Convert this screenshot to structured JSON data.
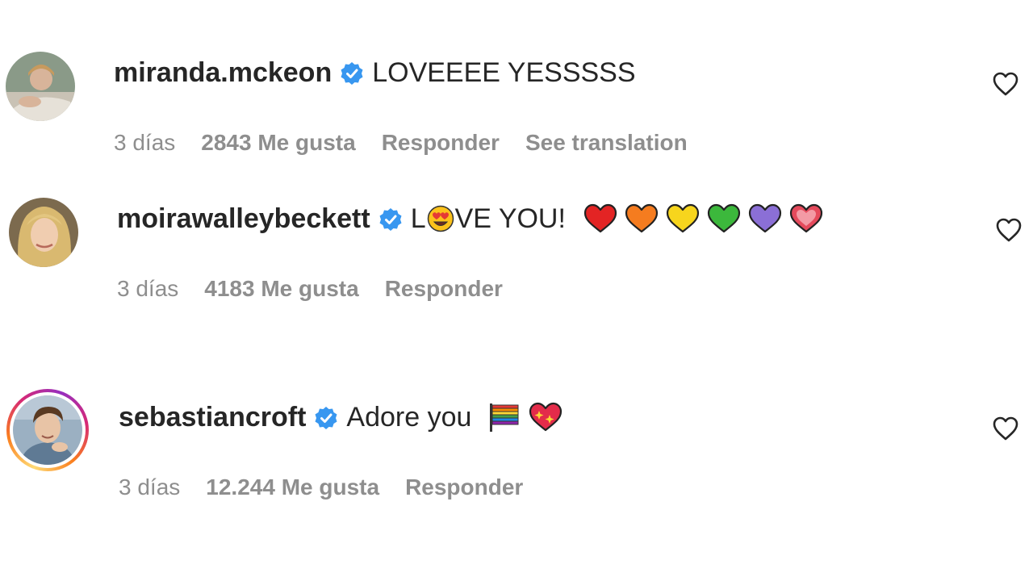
{
  "comments": [
    {
      "username": "miranda.mckeon",
      "text": "LOVEEEE YESSSSS",
      "time": "3 días",
      "likes": "2843 Me gusta",
      "reply": "Responder",
      "translate": "See translation"
    },
    {
      "username": "moirawalleybeckett",
      "text_prefix": "L",
      "text_suffix": "VE YOU!",
      "emojis": [
        "heart-eyes-emoji",
        "red-heart-emoji",
        "orange-heart-emoji",
        "yellow-heart-emoji",
        "green-heart-emoji",
        "purple-heart-emoji",
        "pink-heart-emoji"
      ],
      "time": "3 días",
      "likes": "4183 Me gusta",
      "reply": "Responder"
    },
    {
      "username": "sebastiancroft",
      "text": "Adore you",
      "emojis": [
        "rainbow-flag-emoji",
        "sparkling-heart-emoji"
      ],
      "time": "3 días",
      "likes": "12.244 Me gusta",
      "reply": "Responder"
    }
  ],
  "colors": {
    "verified": "#3897f0",
    "meta": "#8e8e8e",
    "text": "#262626"
  }
}
